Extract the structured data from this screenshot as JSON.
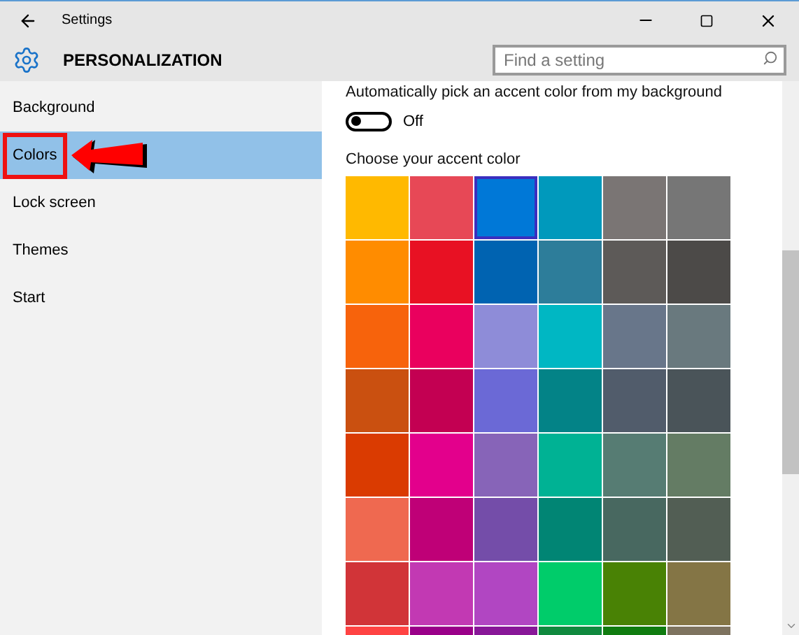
{
  "window": {
    "title": "Settings"
  },
  "header": {
    "title": "PERSONALIZATION",
    "search": {
      "placeholder": "Find a setting"
    }
  },
  "sidebar": {
    "items": [
      {
        "label": "Background",
        "selected": false
      },
      {
        "label": "Colors",
        "selected": true
      },
      {
        "label": "Lock screen",
        "selected": false
      },
      {
        "label": "Themes",
        "selected": false
      },
      {
        "label": "Start",
        "selected": false
      }
    ]
  },
  "auto_accent": {
    "label": "Automatically pick an accent color from my background",
    "on": false,
    "state_text": "Off"
  },
  "accent": {
    "label": "Choose your accent color",
    "swatches": [
      {
        "color": "#ffb900",
        "selected": false
      },
      {
        "color": "#e74856",
        "selected": false
      },
      {
        "color": "#0078d7",
        "selected": true
      },
      {
        "color": "#0099bc",
        "selected": false
      },
      {
        "color": "#7a7574",
        "selected": false
      },
      {
        "color": "#767676",
        "selected": false
      },
      {
        "color": "#ff8c00",
        "selected": false
      },
      {
        "color": "#e81123",
        "selected": false
      },
      {
        "color": "#0063b1",
        "selected": false
      },
      {
        "color": "#2d7d9a",
        "selected": false
      },
      {
        "color": "#5d5a58",
        "selected": false
      },
      {
        "color": "#4c4a48",
        "selected": false
      },
      {
        "color": "#f7630c",
        "selected": false
      },
      {
        "color": "#ea005e",
        "selected": false
      },
      {
        "color": "#8e8cd8",
        "selected": false
      },
      {
        "color": "#00b7c3",
        "selected": false
      },
      {
        "color": "#68768a",
        "selected": false
      },
      {
        "color": "#69797e",
        "selected": false
      },
      {
        "color": "#ca5010",
        "selected": false
      },
      {
        "color": "#c30052",
        "selected": false
      },
      {
        "color": "#6b69d6",
        "selected": false
      },
      {
        "color": "#038387",
        "selected": false
      },
      {
        "color": "#515c6b",
        "selected": false
      },
      {
        "color": "#4a5459",
        "selected": false
      },
      {
        "color": "#da3b01",
        "selected": false
      },
      {
        "color": "#e3008c",
        "selected": false
      },
      {
        "color": "#8764b8",
        "selected": false
      },
      {
        "color": "#00b294",
        "selected": false
      },
      {
        "color": "#567c73",
        "selected": false
      },
      {
        "color": "#647c64",
        "selected": false
      },
      {
        "color": "#ef6950",
        "selected": false
      },
      {
        "color": "#bf0077",
        "selected": false
      },
      {
        "color": "#744da9",
        "selected": false
      },
      {
        "color": "#018574",
        "selected": false
      },
      {
        "color": "#486860",
        "selected": false
      },
      {
        "color": "#525e54",
        "selected": false
      },
      {
        "color": "#d13438",
        "selected": false
      },
      {
        "color": "#c239b3",
        "selected": false
      },
      {
        "color": "#b146c2",
        "selected": false
      },
      {
        "color": "#00cc6a",
        "selected": false
      },
      {
        "color": "#498205",
        "selected": false
      },
      {
        "color": "#847545",
        "selected": false
      },
      {
        "color": "#ff4343",
        "selected": false
      },
      {
        "color": "#9a0089",
        "selected": false
      },
      {
        "color": "#881798",
        "selected": false
      },
      {
        "color": "#10893e",
        "selected": false
      },
      {
        "color": "#107c10",
        "selected": false
      },
      {
        "color": "#7e735f",
        "selected": false
      }
    ]
  }
}
